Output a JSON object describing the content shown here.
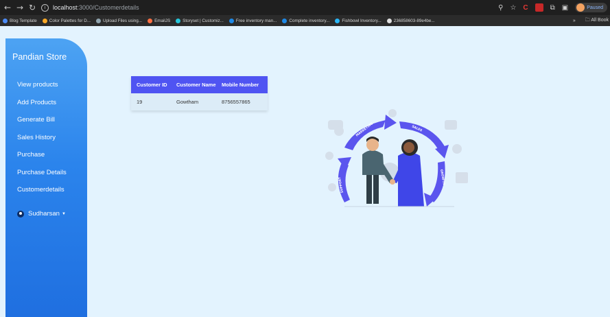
{
  "browser": {
    "url_host": "localhost",
    "url_path": ":3000/Customerdetails",
    "paused_label": "Paused",
    "all_bookmarks_label": "All Book"
  },
  "bookmarks": [
    {
      "label": "Blog Template",
      "color": "#4c8bf5"
    },
    {
      "label": "Color Palettes for D...",
      "color": "#f9a825"
    },
    {
      "label": "Upload Files using...",
      "color": "#90a4ae"
    },
    {
      "label": "EmailJS",
      "color": "#ff7043"
    },
    {
      "label": "Storyset | Customiz...",
      "color": "#26c6da"
    },
    {
      "label": "Free inventory man...",
      "color": "#1e88e5"
    },
    {
      "label": "Complete inventory...",
      "color": "#1e88e5"
    },
    {
      "label": "Fishbowl Inventory...",
      "color": "#29b6f6"
    },
    {
      "label": "236858603-89e4be...",
      "color": "#e0e0e0"
    }
  ],
  "sidebar": {
    "brand": "Pandian Store",
    "items": [
      {
        "label": "View products"
      },
      {
        "label": "Add Products"
      },
      {
        "label": "Generate Bill"
      },
      {
        "label": "Sales History"
      },
      {
        "label": "Purchase"
      },
      {
        "label": "Purchase Details"
      },
      {
        "label": "Customerdetails"
      }
    ],
    "user": "Sudharsan"
  },
  "table": {
    "headers": [
      "Customer ID",
      "Customer Name",
      "Mobile Number"
    ],
    "rows": [
      [
        "19",
        "Gowtham",
        "8756557865"
      ]
    ]
  },
  "illustration": {
    "labels": [
      "MARKETING",
      "SALES",
      "GROWTH",
      "SUPPORT"
    ]
  },
  "colors": {
    "background": "#e3f3fe",
    "sidebar": "#2b84ec",
    "table_header": "#4f54f2",
    "table_row": "#dcecf7"
  }
}
